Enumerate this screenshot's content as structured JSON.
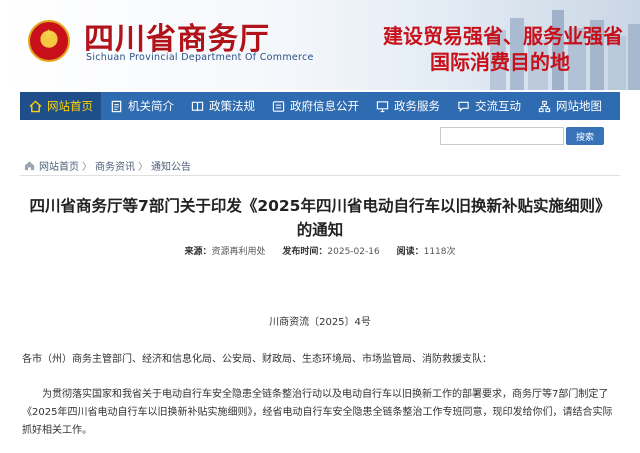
{
  "header": {
    "site_title": "四川省商务厅",
    "site_subtitle": "Sichuan Provincial Department Of Commerce",
    "slogan_line1": "建设贸易强省、服务业强省",
    "slogan_line2": "国际消费目的地",
    "brand_red": "#b0131a",
    "nav_blue": "#2f6bb0"
  },
  "nav": {
    "items": [
      {
        "label": "网站首页",
        "icon": "home-icon",
        "active": true
      },
      {
        "label": "机关简介",
        "icon": "document-icon",
        "active": false
      },
      {
        "label": "政策法规",
        "icon": "book-icon",
        "active": false
      },
      {
        "label": "政府信息公开",
        "icon": "info-icon",
        "active": false
      },
      {
        "label": "政务服务",
        "icon": "monitor-icon",
        "active": false
      },
      {
        "label": "交流互动",
        "icon": "chat-icon",
        "active": false
      },
      {
        "label": "网站地图",
        "icon": "sitemap-icon",
        "active": false
      }
    ]
  },
  "search": {
    "placeholder": "",
    "button_label": "搜索"
  },
  "breadcrumb": {
    "items": [
      "网站首页",
      "商务资讯",
      "通知公告"
    ],
    "separator": "〉"
  },
  "article": {
    "title_line1": "四川省商务厅等7部门关于印发《2025年四川省电动自行车以旧换新补贴实施细则》",
    "title_line2": "的通知",
    "source_label": "来源：",
    "source_value": "资源再利用处",
    "date_label": "发布时间：",
    "date_value": "2025-02-16",
    "views_label": "阅读：",
    "views_value": "1118次",
    "doc_number": "川商资流〔2025〕4号",
    "addressee": "各市（州）商务主管部门、经济和信息化局、公安局、财政局、生态环境局、市场监管局、消防救援支队：",
    "body": "为贯彻落实国家和我省关于电动自行车安全隐患全链条整治行动以及电动自行车以旧换新工作的部署要求，商务厅等7部门制定了《2025年四川省电动自行车以旧换新补贴实施细则》，经省电动自行车安全隐患全链条整治工作专班同意，现印发给你们，请结合实际抓好相关工作。"
  }
}
